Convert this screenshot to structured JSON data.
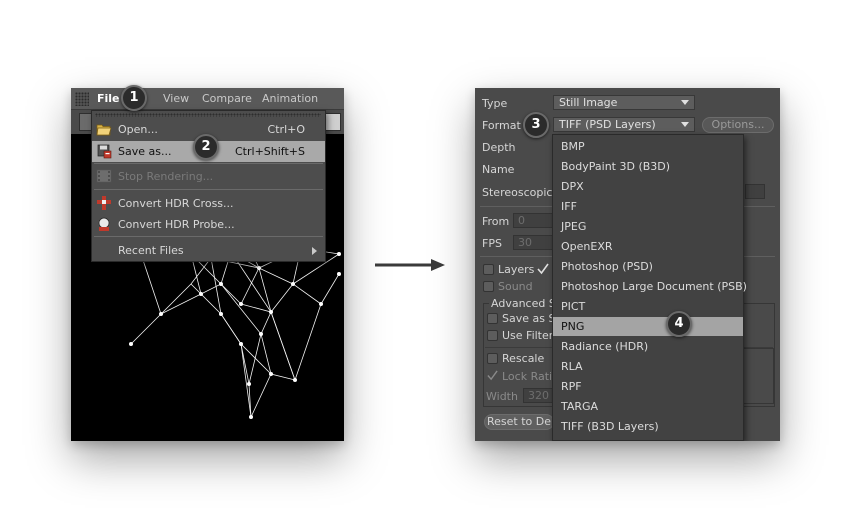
{
  "left_panel": {
    "menubar": {
      "items": [
        {
          "label": "File",
          "active": true
        },
        {
          "label": "View"
        },
        {
          "label": "Compare"
        },
        {
          "label": "Animation"
        }
      ]
    },
    "file_menu": {
      "items": [
        {
          "label": "Open...",
          "shortcut": "Ctrl+O",
          "icon": "folder-open-icon"
        },
        {
          "label": "Save as...",
          "shortcut": "Ctrl+Shift+S",
          "icon": "floppy-save-icon",
          "highlighted": true
        },
        {
          "label": "Stop Rendering...",
          "icon": "film-stop-icon",
          "disabled": true
        },
        {
          "label": "Convert HDR Cross...",
          "icon": "hdr-cross-icon"
        },
        {
          "label": "Convert HDR Probe...",
          "icon": "hdr-probe-icon"
        },
        {
          "label": "Recent Files",
          "submenu": true
        }
      ]
    }
  },
  "right_panel": {
    "type_label": "Type",
    "type_value": "Still Image",
    "format_label": "Format",
    "format_value": "TIFF (PSD Layers)",
    "options_button": "Options...",
    "depth_label": "Depth",
    "name_label": "Name",
    "stereoscopic_label": "Stereoscopic",
    "from_label": "From",
    "from_value": "0",
    "fps_label": "FPS",
    "fps_value": "30",
    "layers_label": "Layers",
    "sound_label": "Sound",
    "advanced_label": "Advanced Se",
    "save_as_label": "Save as Sc",
    "use_filter_label": "Use Filter",
    "rescale_label": "Rescale",
    "lock_ratio_label": "Lock Ratio",
    "width_label": "Width",
    "width_value": "320",
    "reset_button": "Reset to De",
    "format_options": [
      "BMP",
      "BodyPaint 3D (B3D)",
      "DPX",
      "IFF",
      "JPEG",
      "OpenEXR",
      "Photoshop (PSD)",
      "Photoshop Large Document (PSB)",
      "PICT",
      "PNG",
      "Radiance (HDR)",
      "RLA",
      "RPF",
      "TARGA",
      "TIFF (B3D Layers)"
    ],
    "highlighted_option": "PNG"
  },
  "callouts": [
    "1",
    "2",
    "3",
    "4"
  ],
  "colors": {
    "menu_bg": "#4d4d4d",
    "highlight": "#a9a9a9",
    "panel_bg": "#4a4a4a",
    "callout_bg": "#2b2b2b"
  }
}
